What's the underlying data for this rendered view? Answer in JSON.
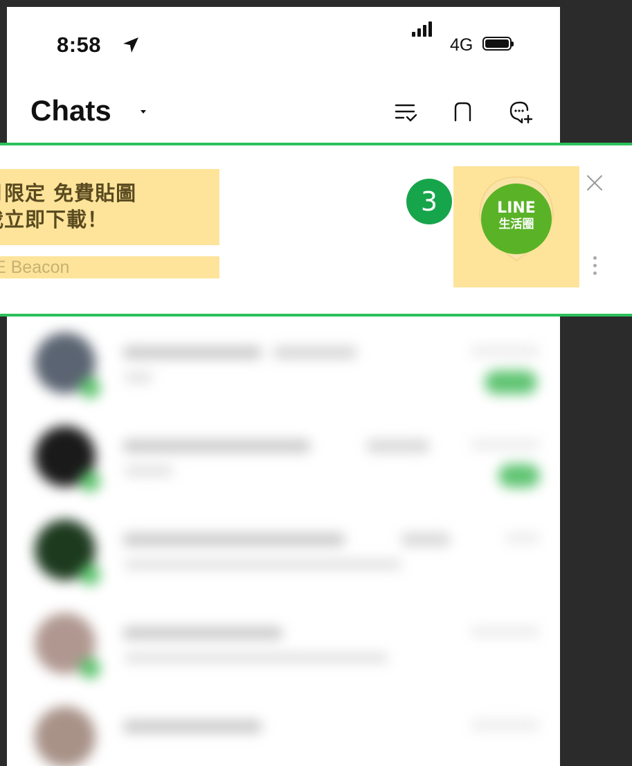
{
  "status_bar": {
    "time": "8:58",
    "network": "4G",
    "icons": [
      "location-arrow-icon",
      "signal-icon",
      "battery-icon"
    ]
  },
  "header": {
    "title": "Chats",
    "icons": [
      "checklist-icon",
      "square-icon",
      "new-chat-icon"
    ]
  },
  "banner": {
    "title_line1": "月限定 免費貼圖",
    "title_line2": "我立即下載！",
    "source": "E Beacon",
    "step_number": "3",
    "logo": {
      "line1": "LINE",
      "line2": "生活圈"
    },
    "highlight_color": "#fde49a",
    "border_color": "#2ac05b"
  },
  "colors": {
    "accent_green": "#2ac05b",
    "badge_green": "#17a54b",
    "logo_green": "#5ab327"
  }
}
